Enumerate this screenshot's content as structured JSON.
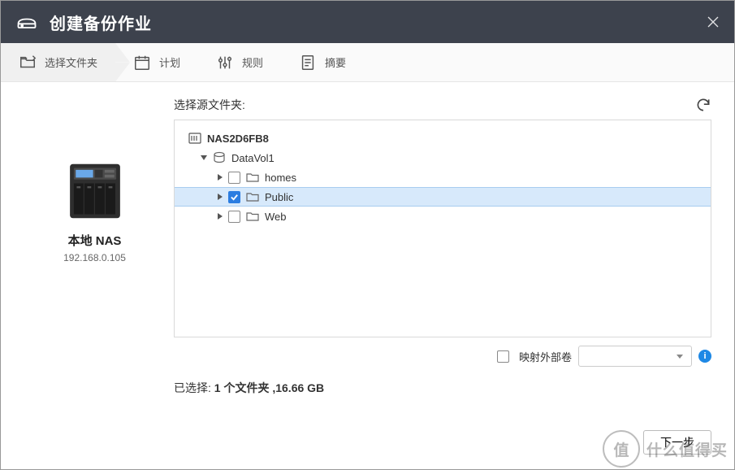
{
  "header": {
    "title": "创建备份作业"
  },
  "tabs": [
    {
      "label": "选择文件夹",
      "active": true
    },
    {
      "label": "计划",
      "active": false
    },
    {
      "label": "规则",
      "active": false
    },
    {
      "label": "摘要",
      "active": false
    }
  ],
  "source": {
    "name": "本地 NAS",
    "ip": "192.168.0.105"
  },
  "main": {
    "panel_title": "选择源文件夹:",
    "map_external_label": "映射外部卷",
    "map_external_checked": false,
    "selected_prefix": "已选择: ",
    "selected_value": "1 个文件夹 ,16.66 GB"
  },
  "tree": {
    "root": {
      "label": "NAS2D6FB8",
      "icon": "nas-root-icon",
      "expanded": true,
      "children": [
        {
          "label": "DataVol1",
          "icon": "disk-icon",
          "expanded": true,
          "children": [
            {
              "label": "homes",
              "icon": "folder-icon",
              "checked": false,
              "selected": false
            },
            {
              "label": "Public",
              "icon": "folder-icon",
              "checked": true,
              "selected": true
            },
            {
              "label": "Web",
              "icon": "folder-icon",
              "checked": false,
              "selected": false
            }
          ]
        }
      ]
    }
  },
  "footer": {
    "next_label": "下一步"
  },
  "watermark": {
    "badge": "值",
    "text": "什么值得买"
  },
  "colors": {
    "accent": "#2b7de1",
    "selection_bg": "#d7e9fb",
    "titlebar_bg": "#3d424d"
  }
}
